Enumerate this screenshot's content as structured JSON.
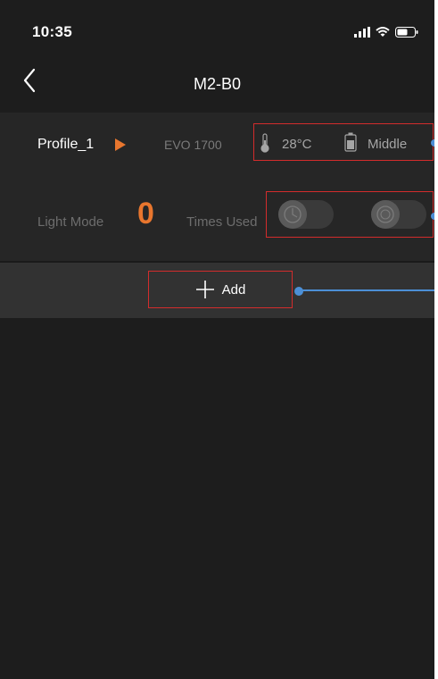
{
  "status_bar": {
    "time": "10:35",
    "icons": [
      "signal-icon",
      "wifi-icon",
      "battery-icon"
    ]
  },
  "nav": {
    "title": "M2-B0",
    "back_icon": "chevron-left-icon"
  },
  "profile": {
    "name": "Profile_1",
    "device_model": "EVO 1700",
    "temperature": "28°C",
    "battery_level": "Middle"
  },
  "usage": {
    "light_mode_label": "Light Mode",
    "light_mode_value": "0",
    "times_used_label": "Times Used"
  },
  "add": {
    "label": "Add"
  },
  "colors": {
    "background": "#1d1d1d",
    "card": "#262626",
    "add_bar": "#323232",
    "accent_orange": "#e8762e",
    "annotation_red": "#d32c2c",
    "annotation_blue": "#4c8fd6"
  }
}
